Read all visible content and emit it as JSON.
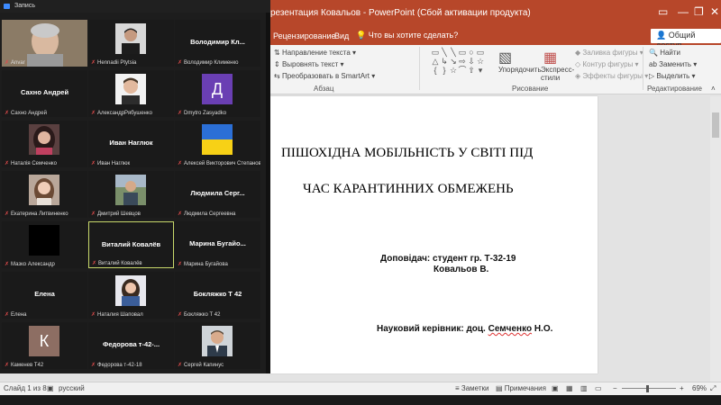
{
  "ppt": {
    "title": "резентация Ковальов - PowerPoint (Сбой активации продукта)",
    "tabs": [
      "Рецензирование",
      "Вид"
    ],
    "search_placeholder": "Что вы хотите сделать?",
    "share": "Общий доступ",
    "ribbon": {
      "text_direction": "Направление текста",
      "align_text": "Выровнять текст",
      "convert_smartart": "Преобразовать в SmartArt",
      "paragraph_label": "Абзац",
      "arrange": "Упорядочить",
      "quick_styles": "Экспресс-стили",
      "shape_fill": "Заливка фигуры",
      "shape_outline": "Контур фигуры",
      "shape_effects": "Эффекты фигуры",
      "drawing_label": "Рисование",
      "find": "Найти",
      "replace": "Заменить",
      "select": "Выделить",
      "editing_label": "Редактирование"
    },
    "slide": {
      "title_line1": "ПІШОХІДНА МОБІЛЬНІСТЬ У СВІТІ ПІД",
      "title_line2": "ЧАС КАРАНТИННИХ ОБМЕЖЕНЬ",
      "speaker_line1": "Доповідач:  студент гр. Т-32-19",
      "speaker_line2": "Ковальов В.",
      "advisor_prefix": "Науковий керівник:  доц. ",
      "advisor_name": "Семченко",
      "advisor_suffix": " Н.О."
    },
    "status": {
      "slide": "Слайд 1 из 8",
      "language": "русский",
      "notes": "Заметки",
      "comments": "Примечания",
      "zoom": "69%"
    }
  },
  "zoom": {
    "window_title": "Запись",
    "tiles": [
      {
        "caption": "Anvar",
        "photo": "grey-man"
      },
      {
        "caption": "Hennadii Ptytsia",
        "photo": "man-dark"
      },
      {
        "caption": "Володимир Клименко",
        "name": "Володимир  Кл..."
      },
      {
        "caption": "Сахно Андрей",
        "name": "Сахно Андрей"
      },
      {
        "caption": "АлександрРябушенко",
        "photo": "man-white"
      },
      {
        "caption": "Dmytro Zasyadko",
        "letter": "Д",
        "letter_color": "#6a3fb3"
      },
      {
        "caption": "Наталія Семченко",
        "photo": "woman-dark"
      },
      {
        "caption": "Иван Наглюк",
        "name": "Иван Наглюк"
      },
      {
        "caption": "Алексей Викторович Степанов",
        "photo": "flag-ua"
      },
      {
        "caption": "Екатерина Литвиненко",
        "photo": "woman-light"
      },
      {
        "caption": "Дмитрий Шевцов",
        "photo": "man-outdoor"
      },
      {
        "caption": "Людмила Сергеевна",
        "name": "Людмила  Серг..."
      },
      {
        "caption": "Мазко Александр",
        "photo": "black"
      },
      {
        "caption": "Виталий Ковалёв",
        "name": "Виталий Ковалёв",
        "active": true
      },
      {
        "caption": "Марина Бугайова",
        "name": "Марина  Бугайо..."
      },
      {
        "caption": "Елена",
        "name": "Елена"
      },
      {
        "caption": "Наталия Шаповал",
        "photo": "woman-blue"
      },
      {
        "caption": "Бокляжко Т 42",
        "name": "Бокляжко Т 42"
      },
      {
        "caption": "Каменев Т42",
        "letter": "К",
        "letter_color": "#8d6e63"
      },
      {
        "caption": "Федорова т-42-18",
        "name": "Федорова т-42-..."
      },
      {
        "caption": "Сергей Капинус",
        "photo": "man-suit"
      }
    ]
  }
}
